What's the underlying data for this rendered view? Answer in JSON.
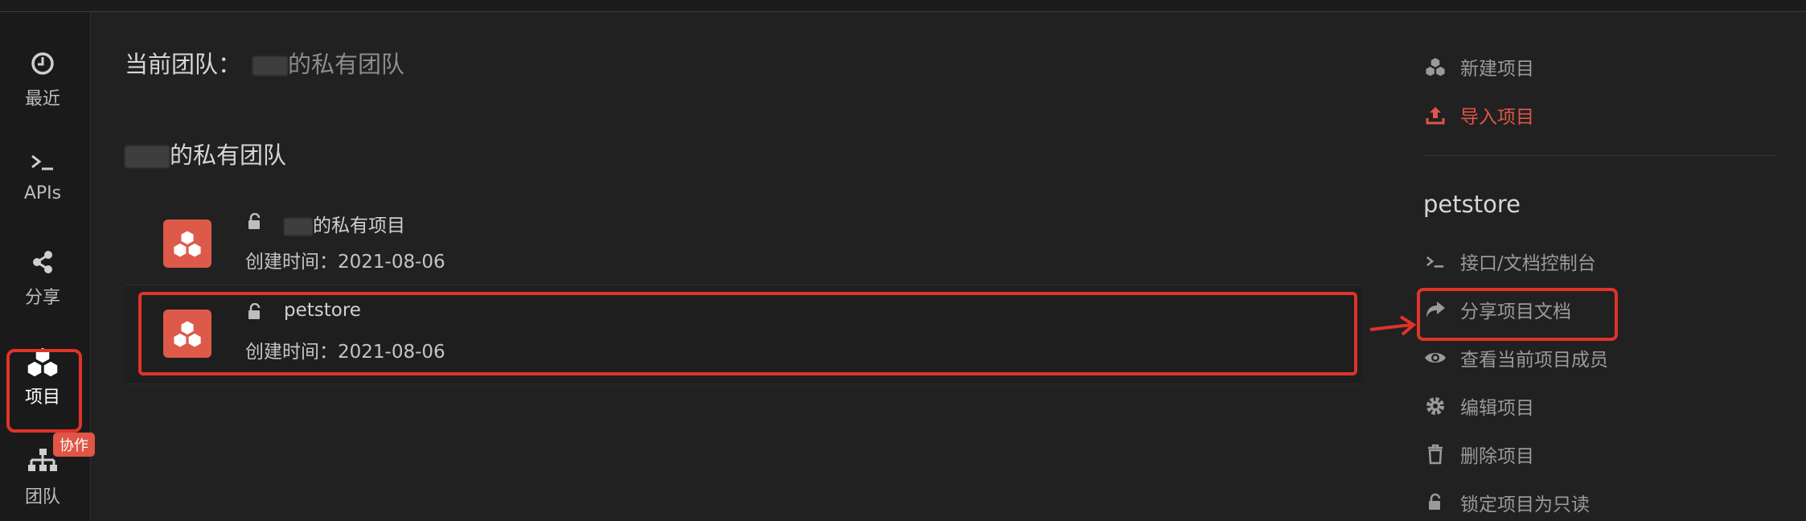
{
  "sidebar": {
    "items": [
      {
        "label": "最近",
        "icon": "clock-icon"
      },
      {
        "label": "APIs",
        "icon": "terminal-icon"
      },
      {
        "label": "分享",
        "icon": "share-icon"
      },
      {
        "label": "项目",
        "icon": "cubes-icon",
        "active": true
      },
      {
        "label": "团队",
        "icon": "sitemap-icon",
        "badge": "协作"
      }
    ]
  },
  "main": {
    "current_team_label": "当前团队：",
    "current_team_value": "的私有团队",
    "section_title": "的私有团队",
    "projects": [
      {
        "name": "的私有项目",
        "created": "创建时间：2021-08-06"
      },
      {
        "name": "petstore",
        "created": "创建时间：2021-08-06"
      }
    ]
  },
  "right_panel": {
    "actions_top": [
      {
        "label": "新建项目",
        "icon": "cubes-icon"
      },
      {
        "label": "导入项目",
        "icon": "upload-icon",
        "color": "#e2544a"
      }
    ],
    "project_title": "petstore",
    "project_actions": [
      {
        "label": "接口/文档控制台",
        "icon": "terminal-icon"
      },
      {
        "label": "分享项目文档",
        "icon": "share-arrow-icon"
      },
      {
        "label": "查看当前项目成员",
        "icon": "eye-icon"
      },
      {
        "label": "编辑项目",
        "icon": "gear-icon"
      },
      {
        "label": "删除项目",
        "icon": "trash-icon"
      },
      {
        "label": "锁定项目为只读",
        "icon": "unlock-icon"
      }
    ]
  },
  "colors": {
    "accent": "#dd5a4b",
    "highlight": "#e0332a",
    "background": "#212121"
  }
}
